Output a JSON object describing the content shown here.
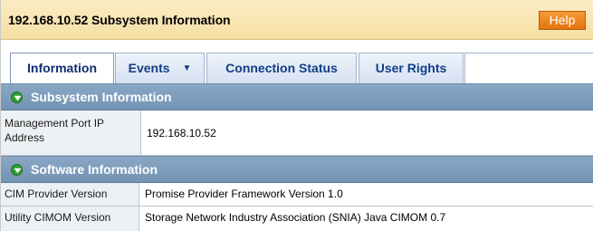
{
  "header": {
    "title": "192.168.10.52 Subsystem Information",
    "help_label": "Help"
  },
  "tabs": [
    {
      "label": "Information",
      "active": true
    },
    {
      "label": "Events",
      "has_dropdown": true
    },
    {
      "label": "Connection Status"
    },
    {
      "label": "User Rights"
    }
  ],
  "sections": {
    "subsystem": {
      "title": "Subsystem Information",
      "rows": [
        {
          "label": "Management Port IP Address",
          "value": "192.168.10.52"
        }
      ]
    },
    "software": {
      "title": "Software Information",
      "rows": [
        {
          "label": "CIM Provider Version",
          "value": "Promise Provider Framework Version 1.0"
        },
        {
          "label": "Utility CIMOM Version",
          "value": "Storage Network Industry Association (SNIA) Java CIMOM 0.7"
        }
      ]
    }
  },
  "colors": {
    "title_bar": "#f6dfa3",
    "help_button": "#e4730c",
    "section_header": "#7f9dbd",
    "tab_text": "#123e87",
    "section_icon": "#2f9e2f"
  },
  "icons": {
    "section_toggle": "collapse-circle-icon",
    "events_dropdown": "chevron-down-icon"
  }
}
